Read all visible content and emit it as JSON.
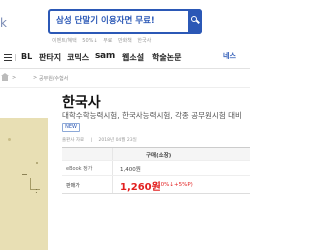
{
  "header": {
    "logo_fragment": "k",
    "search_placeholder": "삼성 단말기 이용자면 무료!",
    "subnav": [
      "이벤트/혜택",
      "50%↓",
      "무료",
      "만화책",
      "한국사"
    ]
  },
  "categories": {
    "bl": "BL",
    "fantasy": "판타지",
    "comics": "코믹스",
    "sam": "sam",
    "webnovel": "웹소설",
    "academic": "학술논문",
    "right_link": "네스"
  },
  "breadcrumb": {
    "separator": ">",
    "items": [
      "",
      "공무원/수험서"
    ]
  },
  "product": {
    "title": "한국사",
    "subtitle": "대학수학능력시험, 한국사능력시험, 각종 공무원시험 대비",
    "badge": "NEW",
    "meta": [
      "출판사 자료",
      "|",
      "2018년 04월 23일"
    ]
  },
  "price_table": {
    "column_header": "구매(소장)",
    "ebook_label": "eBook 정가",
    "ebook_price": "1,400원",
    "sale_label": "판매가",
    "sale_price": "1,260원",
    "sale_discount": "(10%↓+5%P)"
  }
}
